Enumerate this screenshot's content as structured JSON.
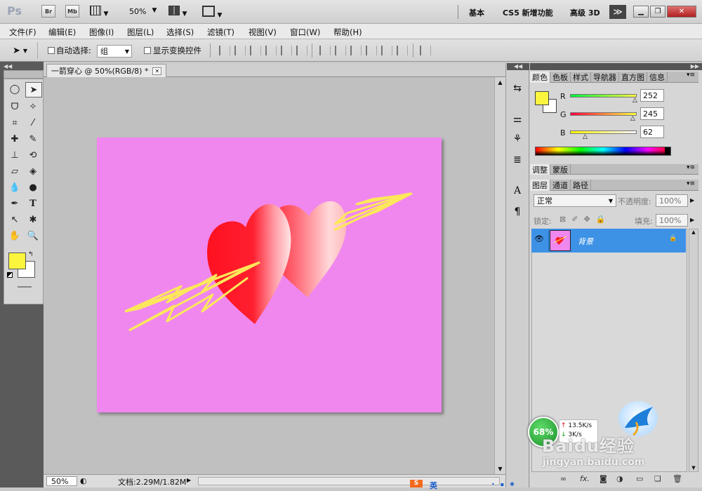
{
  "app": {
    "logo": "Ps",
    "bridge": "Br",
    "minibridge": "Mb",
    "zoom": "50%",
    "workspaces": [
      "基本",
      "CS5 新增功能",
      "高级 3D"
    ],
    "more": "≫"
  },
  "menu": [
    "文件(F)",
    "编辑(E)",
    "图像(I)",
    "图层(L)",
    "选择(S)",
    "滤镜(T)",
    "视图(V)",
    "窗口(W)",
    "帮助(H)"
  ],
  "options": {
    "auto_select_label": "自动选择:",
    "auto_select_value": "组",
    "show_transform_label": "显示变换控件"
  },
  "document": {
    "tab_title": "一箭穿心 @ 50%(RGB/8) *",
    "close": "✕",
    "canvas_color": "#f087ef"
  },
  "status": {
    "zoom": "50%",
    "doc_size": "文档:2.29M/1.82M"
  },
  "panels": {
    "color_tabs": [
      "颜色",
      "色板",
      "样式",
      "导航器",
      "直方图",
      "信息"
    ],
    "r_label": "R",
    "r_value": "252",
    "g_label": "G",
    "g_value": "245",
    "b_label": "B",
    "b_value": "62",
    "adjust_tabs": [
      "调整",
      "蒙版"
    ],
    "layer_tabs": [
      "图层",
      "通道",
      "路径"
    ],
    "blend_mode": "正常",
    "opacity_label": "不透明度:",
    "opacity_value": "100%",
    "lock_label": "锁定:",
    "fill_label": "填充:",
    "fill_value": "100%",
    "layer_name": "背景"
  },
  "colors": {
    "foreground": "#fcf53e",
    "background": "#ffffff",
    "selected_layer": "#3d92e6"
  },
  "overlays": {
    "badge_value": "68%",
    "net_up": "13.5K/s",
    "net_down": "3K/s",
    "watermark": "Baidu经验",
    "watermark_url": "jingyan.baidu.com",
    "ime": "英"
  }
}
